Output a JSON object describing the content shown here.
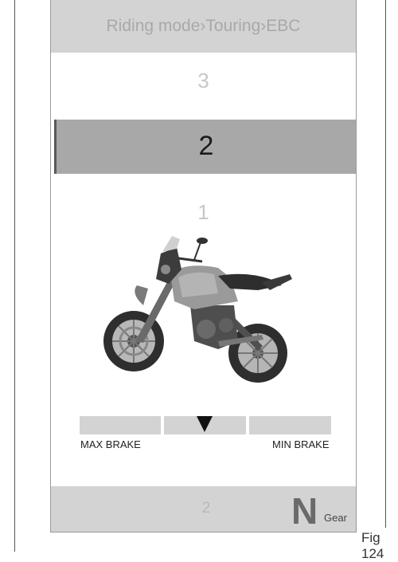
{
  "header": {
    "breadcrumb": "Riding mode›Touring›EBC"
  },
  "options": {
    "upper": "3",
    "selected": "2",
    "lower": "1"
  },
  "scale": {
    "left_label": "MAX BRAKE",
    "right_label": "MIN BRAKE",
    "level_segment": 2,
    "segments": 3
  },
  "footer": {
    "value": "2",
    "gear_letter": "N",
    "gear_label": "Gear"
  },
  "figure_caption": "Fig 124",
  "icons": {
    "motorcycle": "motorcycle-image",
    "marker": "triangle-down-icon"
  },
  "colors": {
    "panel": "#d3d3d3",
    "selected": "#a8a8a8",
    "text_dim": "#c7c7c7"
  }
}
